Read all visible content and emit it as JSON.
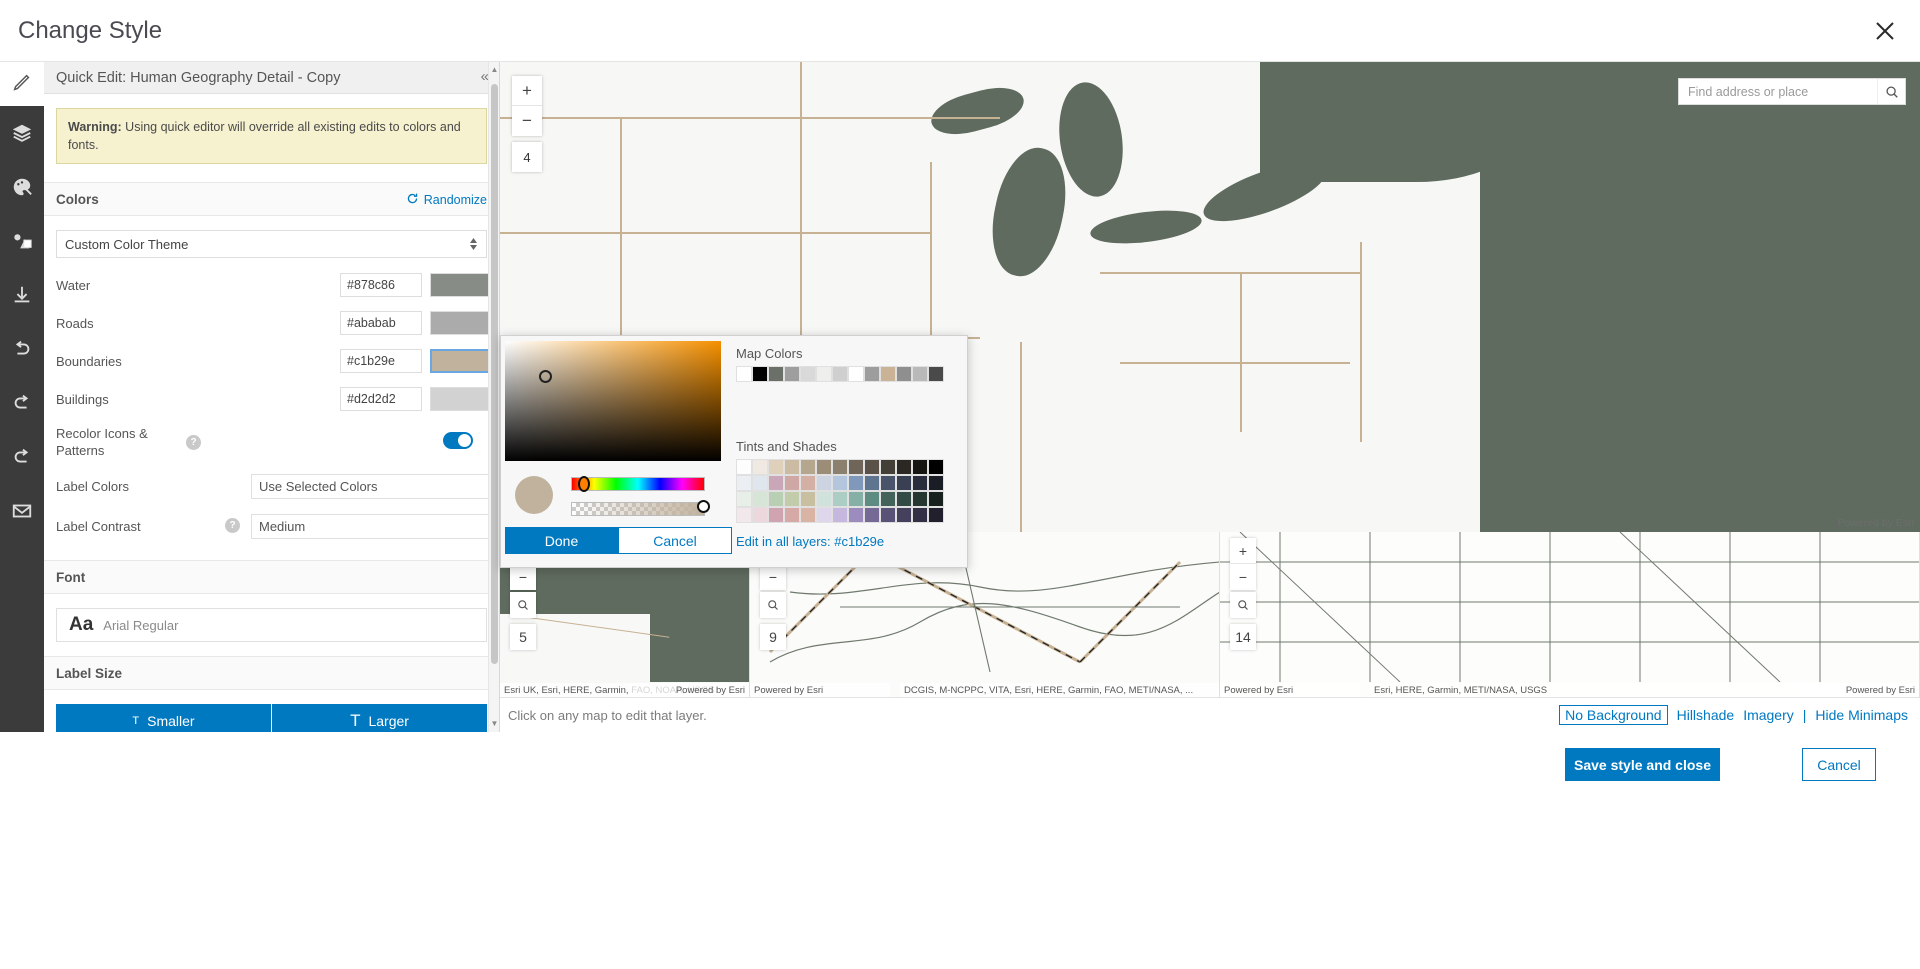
{
  "dialog": {
    "title": "Change Style",
    "close_icon": "close-icon"
  },
  "rail": {
    "items": [
      {
        "icon": "pencil-icon",
        "name": "edit"
      },
      {
        "icon": "layers-icon",
        "name": "layers"
      },
      {
        "icon": "palette-icon",
        "name": "style"
      },
      {
        "icon": "image-icon",
        "name": "images"
      },
      {
        "icon": "download-icon",
        "name": "download"
      },
      {
        "icon": "undo-icon",
        "name": "undo"
      },
      {
        "icon": "redo-icon",
        "name": "redo"
      },
      {
        "icon": "redo-alt-icon",
        "name": "redo-alt"
      },
      {
        "icon": "mail-icon",
        "name": "mail"
      }
    ]
  },
  "panel": {
    "header": "Quick Edit: Human Geography Detail - Copy",
    "collapse_icon": "collapse-left-icon",
    "warning_bold": "Warning:",
    "warning_text": " Using quick editor will override all existing edits to colors and fonts.",
    "colors_section": "Colors",
    "randomize": "Randomize",
    "theme_value": "Custom Color Theme",
    "color_rows": [
      {
        "label": "Water",
        "hex": "#878c86",
        "selected": false
      },
      {
        "label": "Roads",
        "hex": "#ababab",
        "selected": false
      },
      {
        "label": "Boundaries",
        "hex": "#c1b29e",
        "selected": true
      },
      {
        "label": "Buildings",
        "hex": "#d2d2d2",
        "selected": false
      }
    ],
    "recolor_label": "Recolor Icons & Patterns",
    "recolor_toggle_on": true,
    "label_colors_label": "Label Colors",
    "label_colors_value": "Use Selected Colors",
    "label_contrast_label": "Label Contrast",
    "label_contrast_value": "Medium",
    "font_section": "Font",
    "font_aa": "Aa",
    "font_name": "Arial Regular",
    "label_size_section": "Label Size",
    "smaller_label": "Smaller",
    "larger_label": "Larger",
    "help_icon": "help-icon"
  },
  "picker": {
    "map_colors_label": "Map Colors",
    "map_colors": [
      "#ffffff",
      "#000000",
      "#6b7168",
      "#9e9e9e",
      "#d9d9d9",
      "#eeeeec",
      "#cfcfcf",
      "#ffffff",
      "#9d9d9d",
      "#c9b295",
      "#8f8f8f",
      "#b9b9b9",
      "#4a4a4a"
    ],
    "tints_label": "Tints and Shades",
    "tints_rows": [
      [
        "#ffffff",
        "#f1ece4",
        "#e0d4c2",
        "#cdbda4",
        "#b7a display",
        "#000000"
      ],
      [
        "#ffffff",
        "#f1ece4",
        "#ded2bf",
        "#c9b99f",
        "#b5a punct",
        "#000000"
      ]
    ],
    "tints_grid": [
      [
        "#fdfdfd",
        "#efe9e1",
        "#ded0bb",
        "#cbbba2",
        "#b5a68e",
        "#9c8d78",
        "#8b7f6d",
        "#6f6659",
        "#5a5248",
        "#433e36",
        "#2b2823",
        "#171512",
        "#000000"
      ],
      [
        "#ebeff3",
        "#dfe6ee",
        "#c9a7b8",
        "#cfa8a6",
        "#d3b0a3",
        "#ccd4e2",
        "#b4c6de",
        "#8099bb",
        "#5f748f",
        "#49546a",
        "#3a4053",
        "#2a2e3c",
        "#1a1d26"
      ],
      [
        "#e8efe8",
        "#d7e5d7",
        "#b9cfb4",
        "#c2ccab",
        "#c7bf9f",
        "#cfe3dc",
        "#abcdc4",
        "#86b0a6",
        "#5f8c82",
        "#42625a",
        "#334b45",
        "#25352f",
        "#17211d"
      ],
      [
        "#f2e7ea",
        "#ecd7dc",
        "#cfa3b0",
        "#d6a8a6",
        "#d9b3a4",
        "#ded6ea",
        "#c5b7dd",
        "#9c8cbe",
        "#756a95",
        "#5a5276",
        "#45405c",
        "#332f44",
        "#22202d"
      ]
    ],
    "done_label": "Done",
    "cancel_label": "Cancel",
    "edit_all_label": "Edit in all layers: #c1b29e",
    "current_color": "#c1b29e"
  },
  "map": {
    "search_placeholder": "Find address or place",
    "search_icon": "search-icon",
    "zoom_in": "+",
    "zoom_out": "−",
    "zoom_level_main": "4",
    "powered_by": "Powered by Esri",
    "minimaps": [
      {
        "zoom_level": "5",
        "attribution": "Esri UK, Esri, HERE, Garmin, FAO, NOAA, USGS",
        "powered": "Powered by Esri"
      },
      {
        "zoom_level": "9",
        "attribution": "DCGIS, M-NCPPC, VITA, Esri, HERE, Garmin, FAO, METI/NASA, ...",
        "powered": "Powered by Esri"
      },
      {
        "zoom_level": "14",
        "attribution": "Esri, HERE, Garmin, METI/NASA, USGS",
        "powered": "Powered by Esri"
      }
    ],
    "hint": "Click on any map to edit that layer.",
    "bg_options": [
      {
        "label": "No Background",
        "boxed": true
      },
      {
        "label": "Hillshade",
        "boxed": false
      },
      {
        "label": "Imagery",
        "boxed": false
      },
      {
        "label": "Hide Minimaps",
        "boxed": false
      }
    ],
    "bg_divider": "|"
  },
  "footer": {
    "save_label": "Save style and close",
    "cancel_label": "Cancel"
  },
  "colors": {
    "accent": "#0079c1",
    "warning_bg": "#f6f2d0",
    "rail_bg": "#3b3b3b",
    "water": "#5f6b5e",
    "boundary_line": "#c7b193"
  }
}
